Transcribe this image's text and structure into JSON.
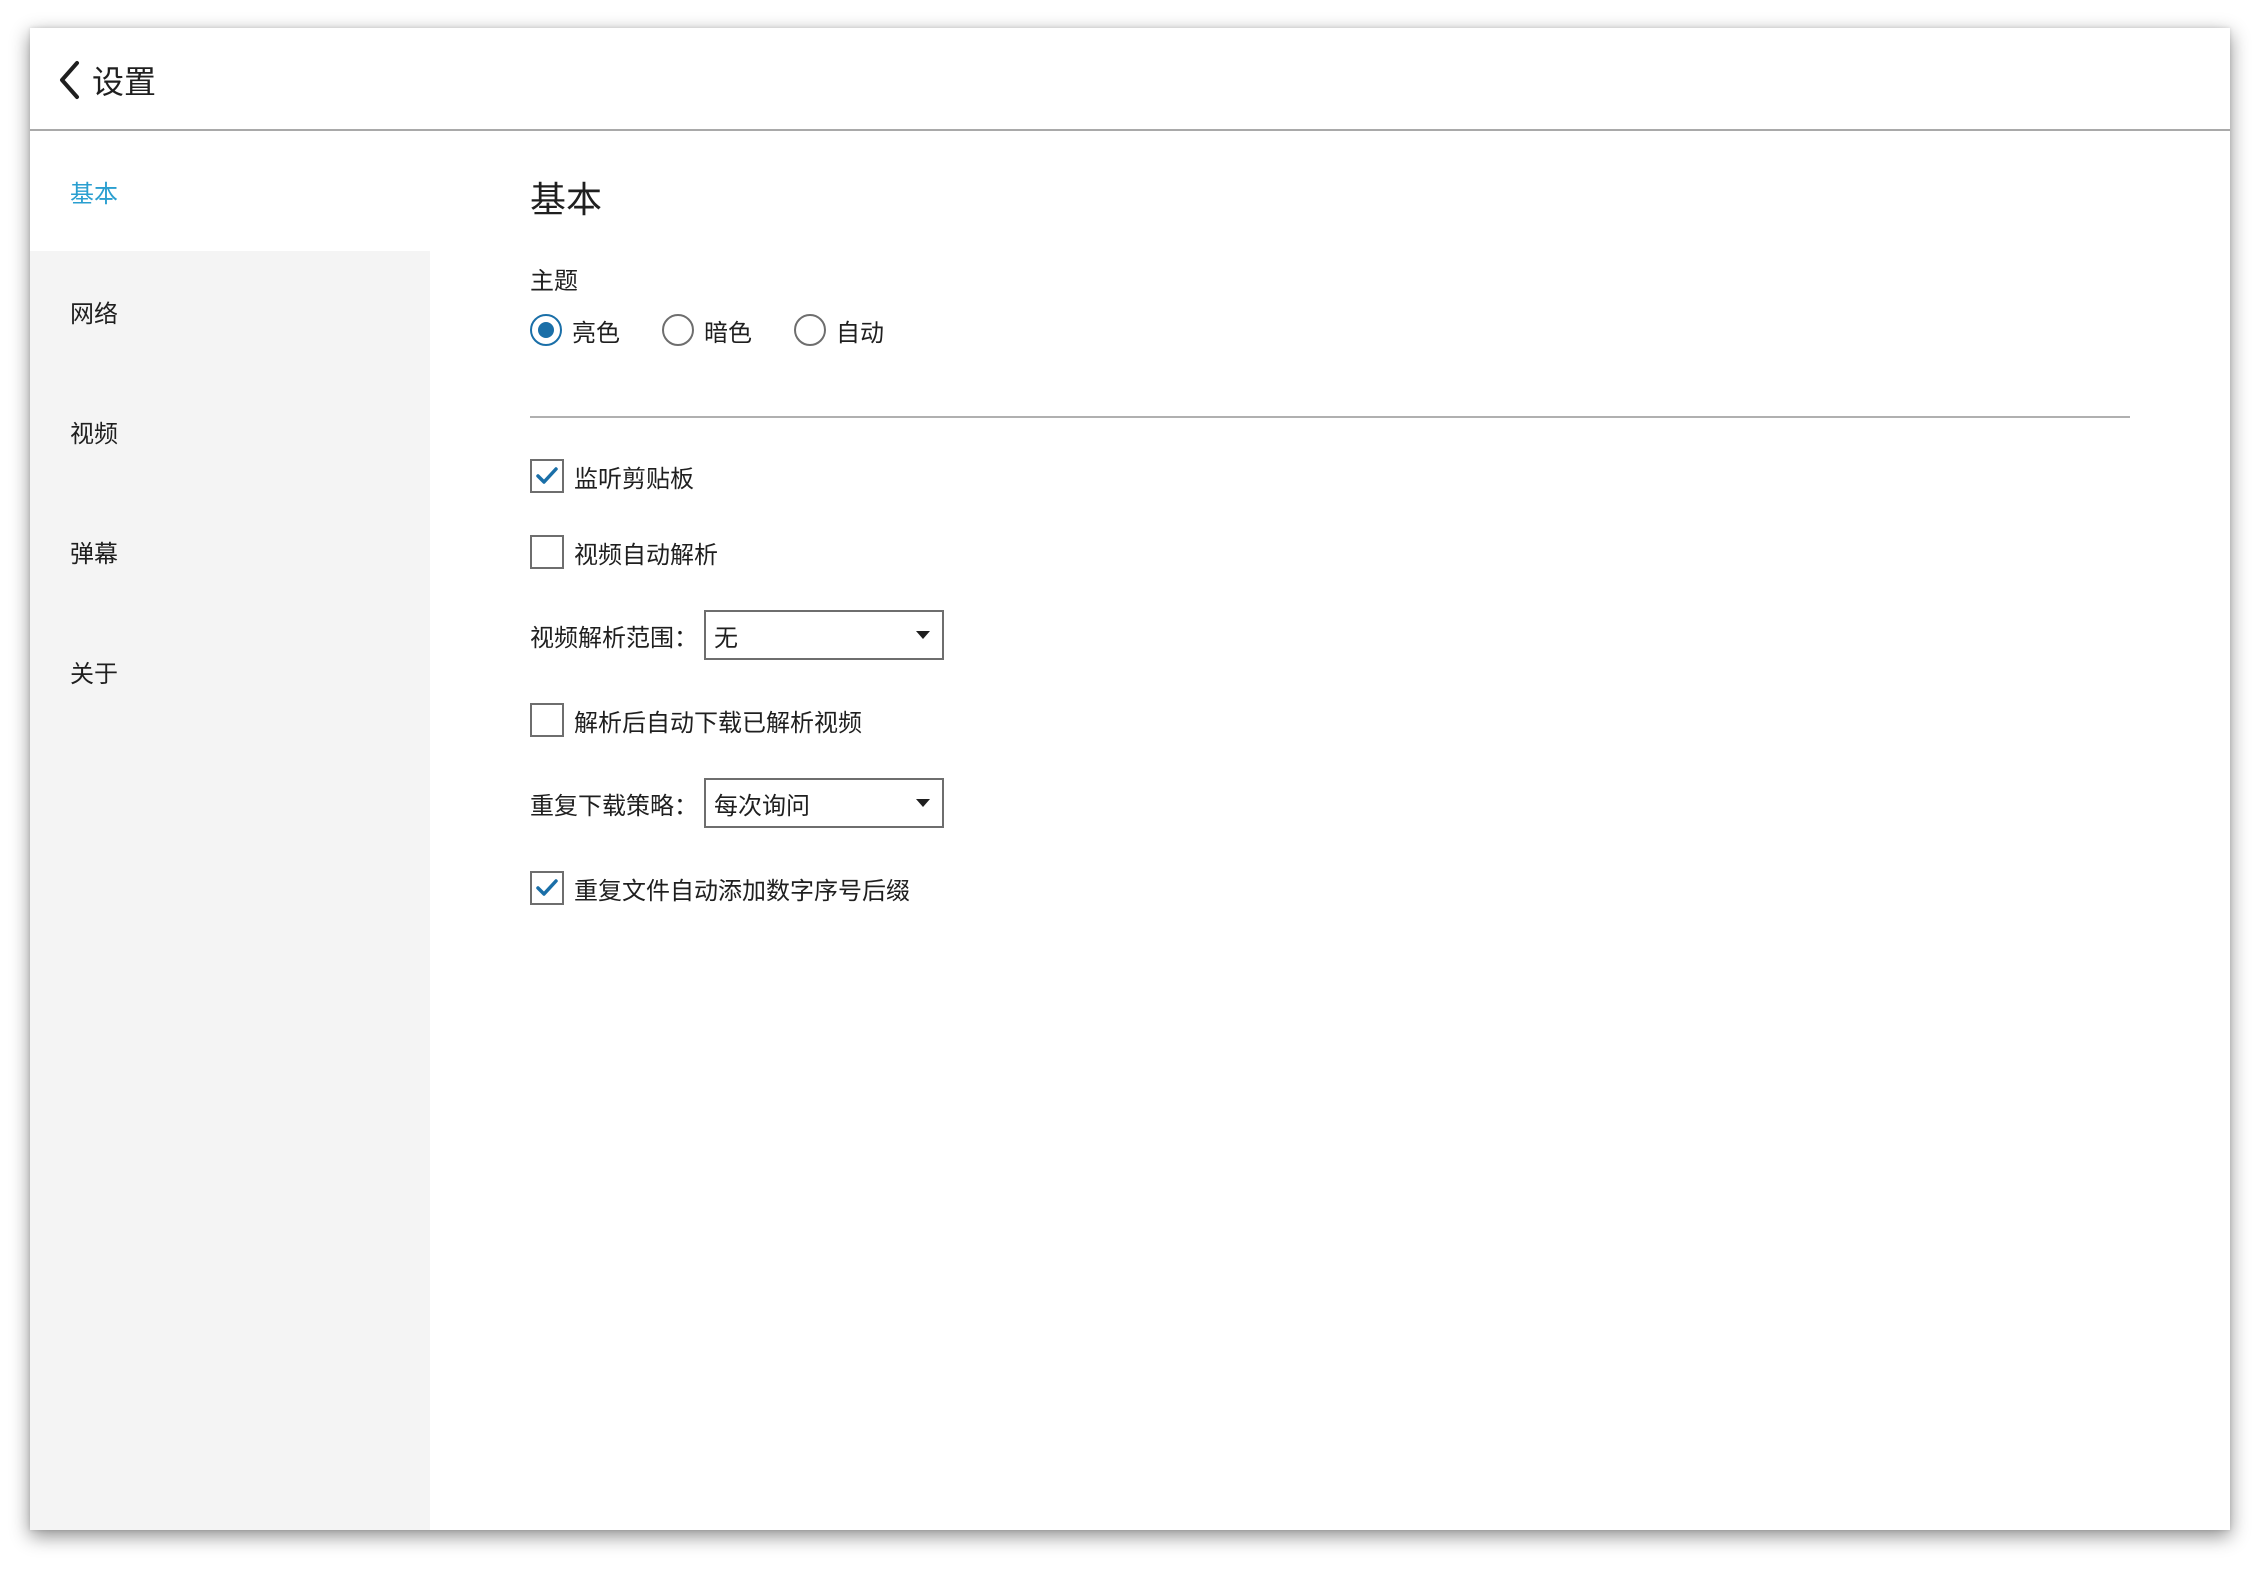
{
  "header": {
    "title": "设置",
    "back_icon": "chevron-left-icon"
  },
  "sidebar": {
    "items": [
      {
        "label": "基本",
        "active": true
      },
      {
        "label": "网络",
        "active": false
      },
      {
        "label": "视频",
        "active": false
      },
      {
        "label": "弹幕",
        "active": false
      },
      {
        "label": "关于",
        "active": false
      }
    ],
    "active_color": "#2a9fd0",
    "background": "#f4f4f4"
  },
  "main": {
    "section_title": "基本",
    "theme": {
      "label": "主题",
      "options": [
        {
          "label": "亮色",
          "checked": true
        },
        {
          "label": "暗色",
          "checked": false
        },
        {
          "label": "自动",
          "checked": false
        }
      ]
    },
    "monitor_clipboard": {
      "label": "监听剪贴板",
      "checked": true
    },
    "auto_parse_video": {
      "label": "视频自动解析",
      "checked": false
    },
    "parse_scope": {
      "label": "视频解析范围：",
      "value": "无"
    },
    "auto_download": {
      "label": "解析后自动下载已解析视频",
      "checked": false
    },
    "duplicate_strategy": {
      "label": "重复下载策略：",
      "value": "每次询问"
    },
    "auto_suffix": {
      "label": "重复文件自动添加数字序号后缀",
      "checked": true
    }
  },
  "accent_color": "#1a6fa8"
}
